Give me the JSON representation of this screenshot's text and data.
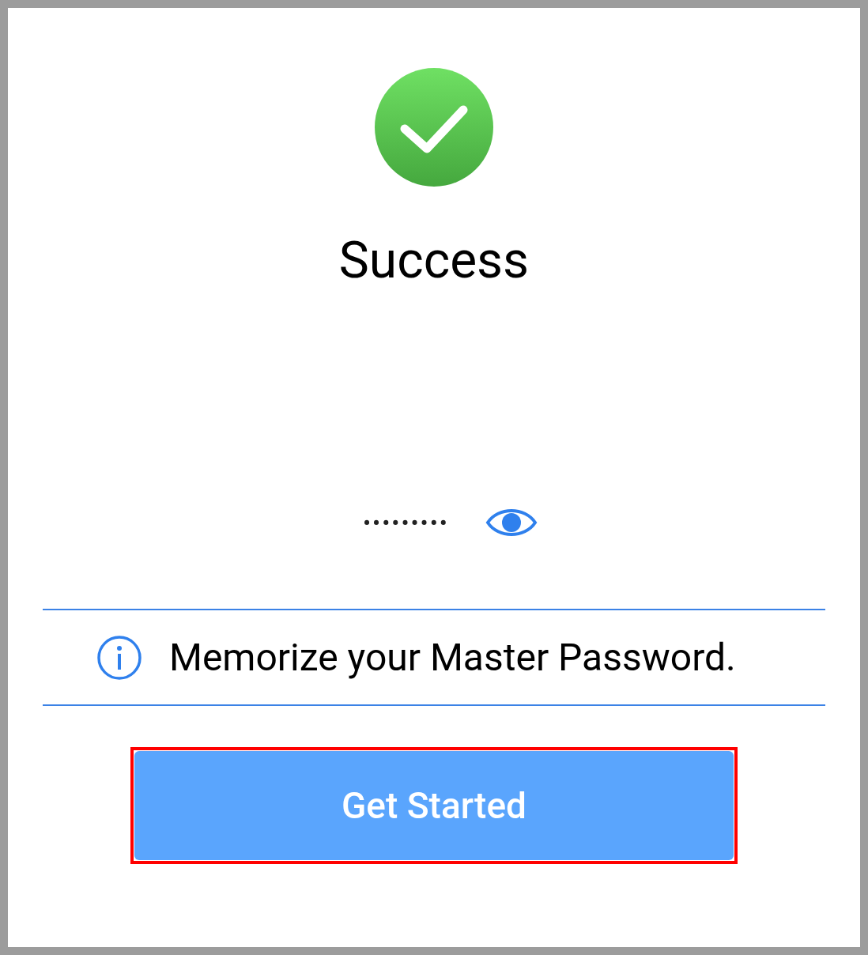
{
  "status": {
    "title": "Success"
  },
  "password": {
    "value": "•••••••••"
  },
  "notice": {
    "text": "Memorize your Master Password."
  },
  "buttons": [
    {
      "label": "Get Started"
    }
  ]
}
